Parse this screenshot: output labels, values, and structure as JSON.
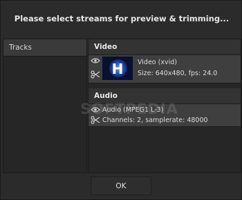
{
  "dialog": {
    "title": "Please select streams for preview & trimming...",
    "ok_label": "OK"
  },
  "left_panel": {
    "header": "Tracks"
  },
  "sections": {
    "video": {
      "header": "Video",
      "stream": {
        "name": "Video (xvid)",
        "details": "Size: 640x480, fps: 24.0",
        "thumbnail_glyph": "H"
      }
    },
    "audio": {
      "header": "Audio",
      "stream": {
        "name": "Audio (MPEG1 L-3)",
        "details": "Channels: 2, samplerate: 48000"
      }
    }
  },
  "watermark": "SOFTPEDIA",
  "icons": {
    "preview": "eye-icon",
    "trim": "scissors-icon"
  }
}
